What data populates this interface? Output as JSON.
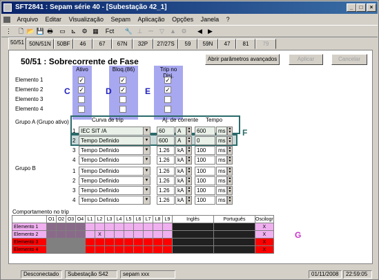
{
  "window": {
    "title": "SFT2841 : Sepam série 40 - [Subestação 42_1]"
  },
  "menu": [
    "Arquivo",
    "Editar",
    "Visualização",
    "Sepam",
    "Aplicação",
    "Opções",
    "Janela",
    "?"
  ],
  "toolbar": {
    "fct_label": "Fct"
  },
  "tabs": [
    "50/51",
    "50N/51N",
    "50BF",
    "46",
    "67",
    "67N",
    "32P",
    "27/27S",
    "59",
    "59N",
    "47",
    "81",
    "79"
  ],
  "panel": {
    "title": "50/51 : Sobrecorrente de Fase",
    "btn_advanced": "Abrir parâmetros avançados",
    "btn_apply": "Aplicar",
    "btn_cancel": "Cancelar",
    "col_ativo": "Ativo",
    "col_bloq": "Bloq.(86)",
    "col_trip": "Trip no Disj.",
    "elements": [
      "Elemento 1",
      "Elemento 2",
      "Elemento 3",
      "Elemento 4"
    ],
    "group_a": "Grupo A  (Grupo ativo)",
    "group_b": "Grupo B",
    "head_curve": "Curva de trip",
    "head_adj": "Aj. de corrente",
    "head_time": "Tempo",
    "letters": {
      "c": "C",
      "d": "D",
      "e": "E",
      "f": "F",
      "g": "G"
    },
    "group_a_rows": [
      {
        "n": "1",
        "curve": "IEC SIT /A",
        "val": "60",
        "unit": "A",
        "time": "600",
        "tunit": "ms"
      },
      {
        "n": "2",
        "curve": "Tempo Definido",
        "val": "600",
        "unit": "A",
        "time": "0",
        "tunit": "ms"
      },
      {
        "n": "3",
        "curve": "Tempo Definido",
        "val": "1.26",
        "unit": "kA",
        "time": "100",
        "tunit": "ms"
      },
      {
        "n": "4",
        "curve": "Tempo Definido",
        "val": "1.26",
        "unit": "kA",
        "time": "100",
        "tunit": "ms"
      }
    ],
    "group_b_rows": [
      {
        "n": "1",
        "curve": "Tempo Definido",
        "val": "1.26",
        "unit": "kA",
        "time": "100",
        "tunit": "ms"
      },
      {
        "n": "2",
        "curve": "Tempo Definido",
        "val": "1.26",
        "unit": "kA",
        "time": "100",
        "tunit": "ms"
      },
      {
        "n": "3",
        "curve": "Tempo Definido",
        "val": "1.26",
        "unit": "kA",
        "time": "100",
        "tunit": "ms"
      },
      {
        "n": "4",
        "curve": "Tempo Definido",
        "val": "1.26",
        "unit": "kA",
        "time": "100",
        "tunit": "ms"
      }
    ],
    "behavior_title": "Comportamento no trip",
    "behavior_cols": [
      "O1",
      "O2",
      "O3",
      "O4",
      "L1",
      "L2",
      "L3",
      "L4",
      "L5",
      "L6",
      "L7",
      "L8",
      "L9",
      "Inglês",
      "Português",
      "Oscilogr"
    ],
    "behavior_rows": [
      "Elemento 1",
      "Elemento 2",
      "Elemento 3",
      "Elemento 4"
    ]
  },
  "status": {
    "conn": "Desconectado",
    "sub": "Subestação S42",
    "sepam": "sepam xxx",
    "date": "01/11/2008",
    "time": "22:59:05"
  },
  "colors": {
    "title_bar": "#0a246a",
    "col_head": "#a8a8f0",
    "pink": "#f0b0f0",
    "red": "#ff0000",
    "teal": "#2a6a6a"
  }
}
